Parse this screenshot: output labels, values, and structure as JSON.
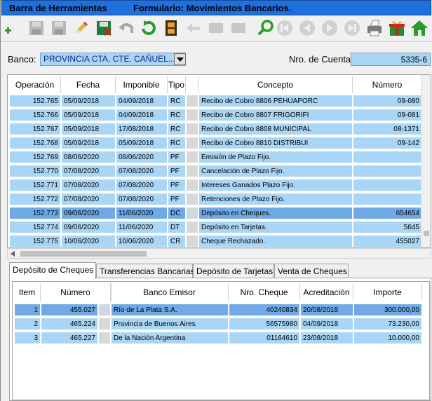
{
  "window": {
    "title": "Barra de Herramientas",
    "form_title": "Formulario: Movimientos Bancarios."
  },
  "toolbar": {
    "buttons": [
      {
        "name": "add",
        "icon": "plus-icon"
      },
      {
        "name": "save",
        "icon": "floppy-icon"
      },
      {
        "name": "save-all",
        "icon": "floppy-icon"
      },
      {
        "name": "edit",
        "icon": "pencil-icon"
      },
      {
        "name": "delete",
        "icon": "delete-floppy-icon"
      },
      {
        "name": "undo",
        "icon": "undo-icon"
      },
      {
        "name": "refresh",
        "icon": "refresh-icon"
      },
      {
        "name": "film",
        "icon": "film-icon"
      },
      {
        "name": "back",
        "icon": "arrow-left-icon"
      },
      {
        "name": "disabled1",
        "icon": "blank-icon"
      },
      {
        "name": "disabled2",
        "icon": "blank-icon"
      },
      {
        "name": "search",
        "icon": "search-icon"
      },
      {
        "name": "first",
        "icon": "first-icon"
      },
      {
        "name": "prev",
        "icon": "prev-icon"
      },
      {
        "name": "next",
        "icon": "next-icon"
      },
      {
        "name": "last",
        "icon": "last-icon"
      },
      {
        "name": "print",
        "icon": "printer-icon"
      },
      {
        "name": "gift",
        "icon": "gift-icon"
      },
      {
        "name": "home",
        "icon": "home-icon"
      }
    ]
  },
  "form": {
    "banco_label": "Banco:",
    "banco_value": "PROVINCIA CTA. CTE. CAÑUEL...",
    "cuenta_label": "Nro. de Cuenta:",
    "cuenta_value": "5335-6"
  },
  "movimientos": {
    "columns": [
      "Operación",
      "Fecha",
      "Imponible",
      "Tipo",
      "",
      "Concepto",
      "Número"
    ],
    "rows": [
      {
        "operacion": "152.765",
        "fecha": "05/09/2018",
        "imponible": "04/09/2018",
        "tipo": "RC",
        "concepto": "Recibo de Cobro 8806 PEHUAPORC",
        "numero": "09-080"
      },
      {
        "operacion": "152.766",
        "fecha": "05/09/2018",
        "imponible": "04/09/2018",
        "tipo": "RC",
        "concepto": "Recibo de Cobro 8807 FRIGORIFI",
        "numero": "09-081"
      },
      {
        "operacion": "152.767",
        "fecha": "05/09/2018",
        "imponible": "17/08/2018",
        "tipo": "RC",
        "concepto": "Recibo de Cobro 8808 MUNICIPAL",
        "numero": "08-1371"
      },
      {
        "operacion": "152.768",
        "fecha": "05/09/2018",
        "imponible": "05/09/2018",
        "tipo": "RC",
        "concepto": "Recibo de Cobro 8810 DISTRIBUI",
        "numero": "09-142"
      },
      {
        "operacion": "152.769",
        "fecha": "08/06/2020",
        "imponible": "08/06/2020",
        "tipo": "PF",
        "concepto": "Emisión de Plazo Fijo.",
        "numero": ""
      },
      {
        "operacion": "152.770",
        "fecha": "07/08/2020",
        "imponible": "07/08/2020",
        "tipo": "PF",
        "concepto": "Cancelación de Plazo Fijo.",
        "numero": ""
      },
      {
        "operacion": "152.771",
        "fecha": "07/08/2020",
        "imponible": "07/08/2020",
        "tipo": "PF",
        "concepto": "Intereses Ganados Plazo Fijo.",
        "numero": ""
      },
      {
        "operacion": "152.772",
        "fecha": "07/08/2020",
        "imponible": "07/08/2020",
        "tipo": "PF",
        "concepto": "Retenciones de Plazo Fijo.",
        "numero": ""
      },
      {
        "operacion": "152.773",
        "fecha": "09/06/2020",
        "imponible": "11/06/2020",
        "tipo": "DC",
        "concepto": "Depósito en Cheques.",
        "numero": "654654",
        "selected": true
      },
      {
        "operacion": "152.774",
        "fecha": "09/06/2020",
        "imponible": "11/06/2020",
        "tipo": "DT",
        "concepto": "Depósito en Tarjetas.",
        "numero": "5645"
      },
      {
        "operacion": "152.775",
        "fecha": "10/06/2020",
        "imponible": "10/06/2020",
        "tipo": "CR",
        "concepto": "Cheque Rechazado.",
        "numero": "455027"
      }
    ]
  },
  "tabs": [
    {
      "label": "Depósito de Cheques",
      "active": true
    },
    {
      "label": "Transferencias Bancarias",
      "active": false
    },
    {
      "label": "Depósito de Tarjetas",
      "active": false
    },
    {
      "label": "Venta de Cheques",
      "active": false
    }
  ],
  "cheques": {
    "columns": [
      "Item",
      "Número",
      "",
      "Banco Emisor",
      "Nro. Cheque",
      "Acreditación",
      "Importe"
    ],
    "rows": [
      {
        "item": "1",
        "numero": "455.027",
        "banco": "Río de La Plata S.A.",
        "nro_cheque": "40240834",
        "acreditacion": "20/08/2018",
        "importe": "300.000,00",
        "selected": true
      },
      {
        "item": "2",
        "numero": "465.224",
        "banco": "Provincia de Buenos Aires",
        "nro_cheque": "56575980",
        "acreditacion": "04/09/2018",
        "importe": "73.230,00"
      },
      {
        "item": "3",
        "numero": "465.227",
        "banco": "De la Nación Argentina",
        "nro_cheque": "01164610",
        "acreditacion": "23/08/2018",
        "importe": "10.000,00"
      }
    ]
  },
  "colors": {
    "titlebar": "#1f6fdc",
    "cell": "#a9d6f7",
    "cell_selected": "#6fa9e6"
  }
}
